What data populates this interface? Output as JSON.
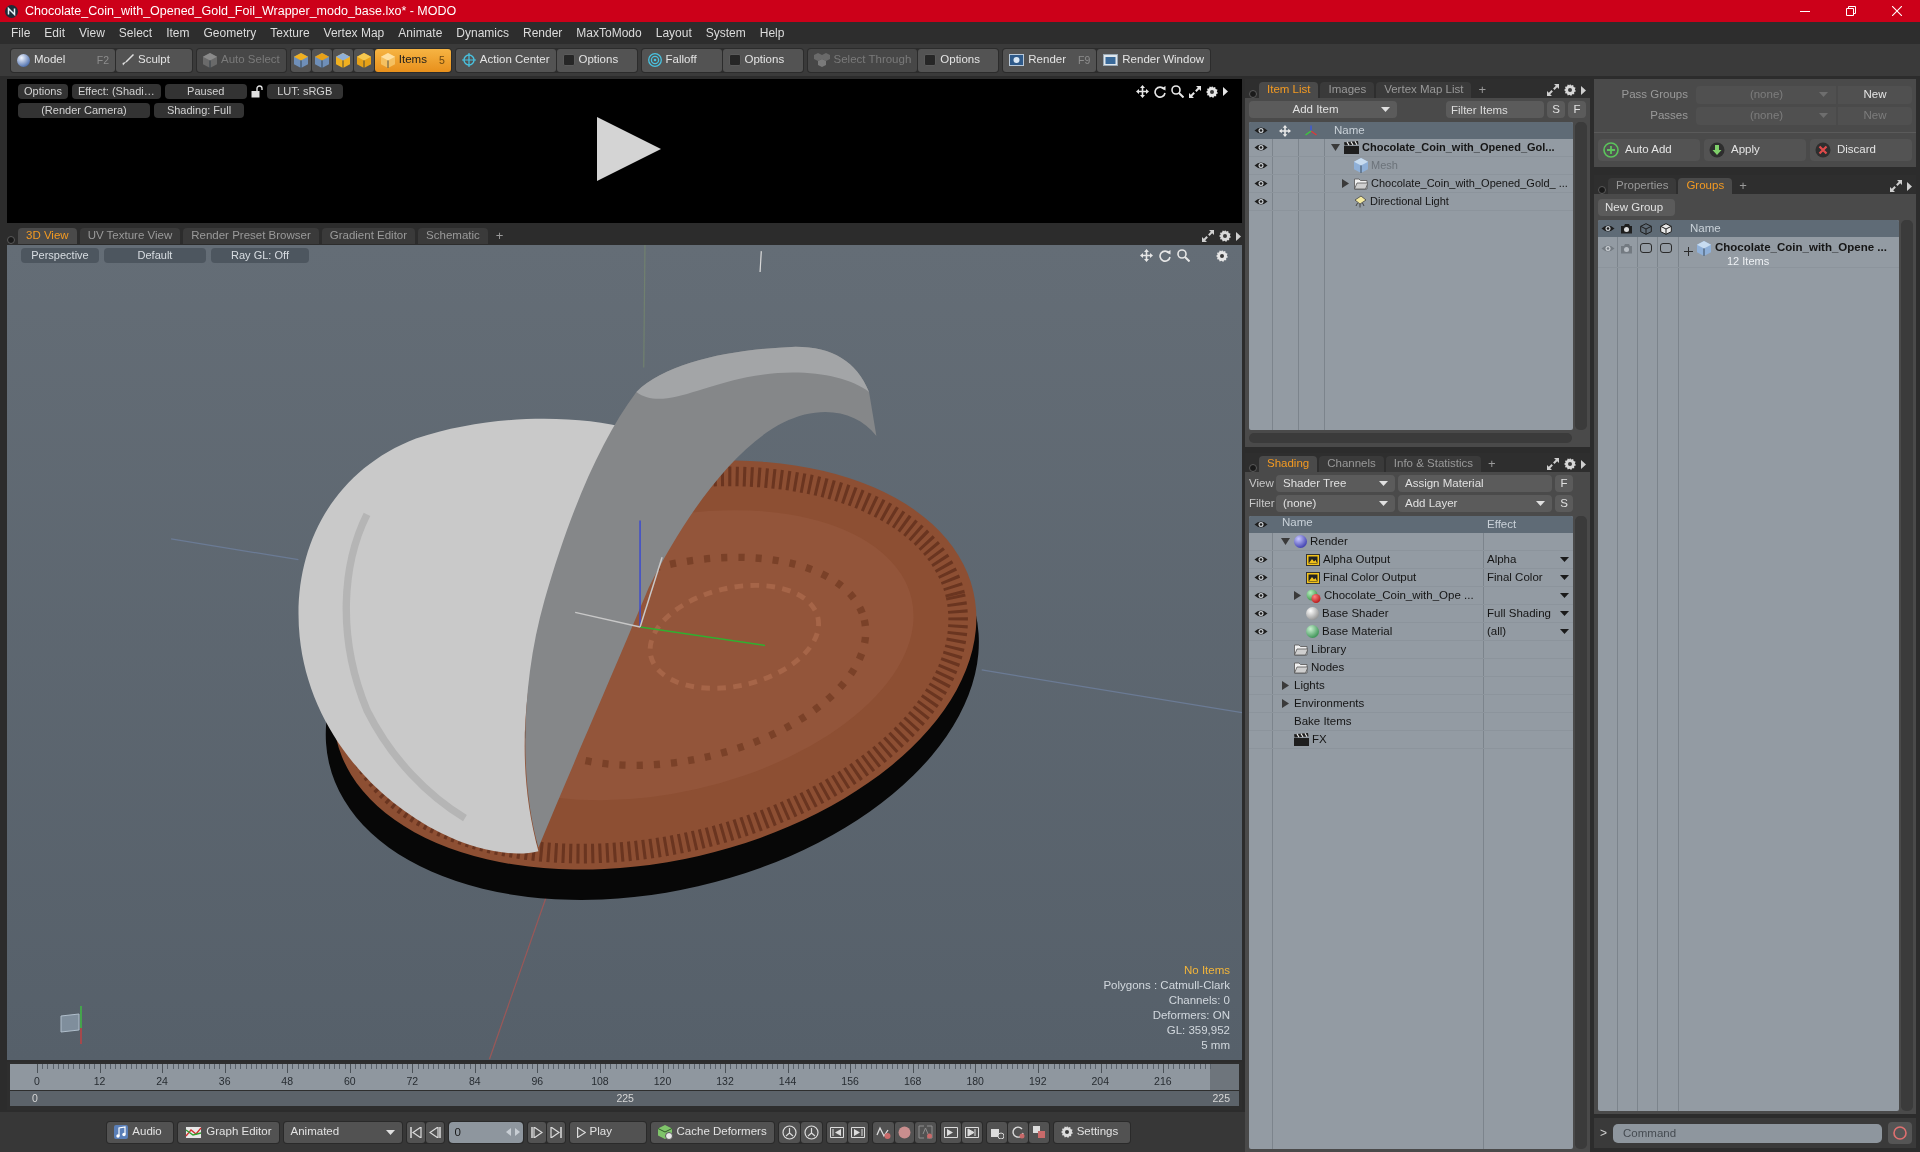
{
  "window": {
    "title": "Chocolate_Coin_with_Opened_Gold_Foil_Wrapper_modo_base.lxo* - MODO"
  },
  "menu": [
    "File",
    "Edit",
    "View",
    "Select",
    "Item",
    "Geometry",
    "Texture",
    "Vertex Map",
    "Animate",
    "Dynamics",
    "Render",
    "MaxToModo",
    "Layout",
    "System",
    "Help"
  ],
  "toolbar": {
    "modes": [
      {
        "label": "Model",
        "shortcut": "F2"
      },
      {
        "label": "Sculpt"
      }
    ],
    "auto_select": {
      "label": "Auto Select",
      "disabled": true
    },
    "select_modes": [
      {
        "selected": false
      },
      {
        "selected": false
      },
      {
        "selected": false
      },
      {
        "selected": false
      },
      {
        "label": "Items",
        "shortcut": "5",
        "selected": true
      }
    ],
    "tools": [
      {
        "kind": "center",
        "label": "Action Center",
        "disabled": false
      },
      {
        "kind": "options",
        "label": "Options",
        "disabled": false
      },
      {
        "kind": "falloff",
        "label": "Falloff",
        "disabled": false
      },
      {
        "kind": "options",
        "label": "Options",
        "disabled": false
      },
      {
        "kind": "through",
        "label": "Select Through",
        "disabled": true
      },
      {
        "kind": "options",
        "label": "Options",
        "disabled": false
      }
    ],
    "render": [
      {
        "label": "Render",
        "shortcut": "F9"
      },
      {
        "label": "Render Window"
      }
    ]
  },
  "render_preview": {
    "row_1": [
      "Options",
      "Effect: (Shadi…",
      "Paused"
    ],
    "lut": "LUT: sRGB",
    "row_2": [
      "(Render Camera)",
      "Shading: Full"
    ]
  },
  "viewport": {
    "tabs": [
      {
        "label": "3D View",
        "selected": true
      },
      {
        "label": "UV Texture View",
        "selected": false
      },
      {
        "label": "Render Preset Browser",
        "selected": false
      },
      {
        "label": "Gradient Editor",
        "selected": false
      },
      {
        "label": "Schematic",
        "selected": false
      }
    ],
    "add_tab": "+",
    "buttons": [
      "Perspective",
      "Default",
      "Ray GL: Off"
    ],
    "info": [
      {
        "kind": "status",
        "text": "No Items"
      },
      {
        "kind": "stat",
        "text": "Polygons : Catmull-Clark"
      },
      {
        "kind": "stat",
        "text": "Channels: 0"
      },
      {
        "kind": "stat",
        "text": "Deformers: ON"
      },
      {
        "kind": "stat",
        "text": "GL: 359,952"
      },
      {
        "kind": "stat",
        "text": "5 mm"
      }
    ]
  },
  "timeline": {
    "ticks": [
      "0",
      "12",
      "24",
      "36",
      "48",
      "60",
      "72",
      "84",
      "96",
      "108",
      "120",
      "132",
      "144",
      "156",
      "168",
      "180",
      "192",
      "204",
      "216"
    ],
    "range_start": "0",
    "range_middle": "225",
    "range_end": "225"
  },
  "transport": {
    "audio": "Audio",
    "graph_editor": "Graph Editor",
    "key_mode": "Animated",
    "frame": "0",
    "play": "Play",
    "cache": "Cache Deformers",
    "settings": "Settings"
  },
  "item_list": {
    "tabs": [
      {
        "label": "Item List",
        "selected": true
      },
      {
        "label": "Images",
        "selected": false
      },
      {
        "label": "Vertex Map List",
        "selected": false
      }
    ],
    "add_tab": "+",
    "add_item": "Add Item",
    "filter": {
      "placeholder": "Filter Items"
    },
    "toggles": [
      "S",
      "F"
    ],
    "name_header": "Name",
    "items": [
      {
        "name": "Chocolate_Coin_with_Opened_Gol...",
        "kind": "scene",
        "expanded": true,
        "visible": true,
        "disabled": false,
        "children": [
          {
            "name": "Mesh",
            "kind": "mesh",
            "visible": true,
            "disabled": true
          },
          {
            "name": "Chocolate_Coin_with_Opened_Gold_ ...",
            "kind": "group",
            "expanded": false,
            "visible": true,
            "disabled": false
          },
          {
            "name": "Directional Light",
            "kind": "light",
            "visible": true,
            "disabled": false
          }
        ]
      }
    ]
  },
  "shading": {
    "tabs": [
      {
        "label": "Shading",
        "selected": true
      },
      {
        "label": "Channels",
        "selected": false
      },
      {
        "label": "Info & Statistics",
        "selected": false
      }
    ],
    "add_tab": "+",
    "view_label": "View",
    "view": "Shader Tree",
    "assign": "Assign Material",
    "assign_key": "F",
    "filter_label": "Filter",
    "filter": "(none)",
    "add_layer": "Add Layer",
    "filter_key": "S",
    "columns": [
      "Name",
      "Effect"
    ],
    "layers": [
      {
        "name": "Render",
        "kind": "render",
        "expanded": true,
        "children": [
          {
            "name": "Alpha Output",
            "kind": "output",
            "effect": "Alpha",
            "visible": true
          },
          {
            "name": "Final Color Output",
            "kind": "output",
            "effect": "Final Color",
            "visible": true
          },
          {
            "name": "Chocolate_Coin_with_Ope ...",
            "kind": "material_group",
            "expanded": false,
            "visible": true
          },
          {
            "name": "Base Shader",
            "kind": "shader",
            "effect": "Full Shading",
            "visible": true
          },
          {
            "name": "Base Material",
            "kind": "material",
            "effect": "(all)",
            "visible": true
          }
        ]
      },
      {
        "name": "Library",
        "kind": "folder"
      },
      {
        "name": "Nodes",
        "kind": "folder"
      },
      {
        "name": "Lights",
        "kind": "category",
        "expanded": false
      },
      {
        "name": "Environments",
        "kind": "category",
        "expanded": false
      },
      {
        "name": "Bake Items",
        "kind": "category"
      },
      {
        "name": "FX",
        "kind": "fx"
      }
    ]
  },
  "passes": {
    "rows": [
      {
        "label": "Pass Groups",
        "value": "(none)",
        "button": "New",
        "disabled": false
      },
      {
        "label": "Passes",
        "value": "(none)",
        "button": "New",
        "disabled": true
      }
    ],
    "actions": [
      "Auto Add",
      "Apply",
      "Discard"
    ]
  },
  "groups": {
    "tabs": [
      {
        "label": "Properties",
        "selected": false
      },
      {
        "label": "Groups",
        "selected": true
      }
    ],
    "add_tab": "+",
    "new_group": "New Group",
    "name_header": "Name",
    "rows": [
      {
        "name": "Chocolate_Coin_with_Opene ...",
        "count": "12 Items"
      }
    ]
  },
  "command": {
    "prompt": ">",
    "placeholder": "Command"
  }
}
